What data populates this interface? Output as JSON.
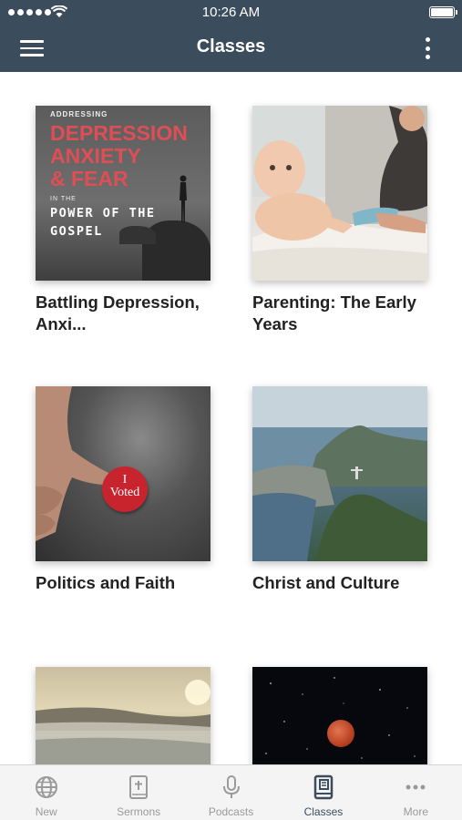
{
  "status_bar": {
    "time": "10:26 AM"
  },
  "header": {
    "title": "Classes"
  },
  "classes": [
    {
      "title": "Battling Depression, Anxi...",
      "artwork": {
        "top_text": "ADDRESSING",
        "headline": [
          "DEPRESSION",
          "ANXIETY",
          "& FEAR"
        ],
        "in_the": "IN THE",
        "subline": [
          "POWER OF THE",
          "GOSPEL"
        ]
      }
    },
    {
      "title": "Parenting: The Early Years"
    },
    {
      "title": "Politics and Faith",
      "artwork": {
        "sticker": [
          "I",
          "Voted"
        ]
      }
    },
    {
      "title": "Christ and Culture"
    },
    {
      "title": ""
    },
    {
      "title": ""
    }
  ],
  "tabs": [
    {
      "label": "New",
      "icon": "globe-icon"
    },
    {
      "label": "Sermons",
      "icon": "bible-icon"
    },
    {
      "label": "Podcasts",
      "icon": "microphone-icon"
    },
    {
      "label": "Classes",
      "icon": "book-icon",
      "active": true
    },
    {
      "label": "More",
      "icon": "ellipsis-icon"
    }
  ],
  "colors": {
    "header_bg": "#3b4d5c",
    "accent_red": "#e04e55",
    "tab_inactive": "#9a9a9a",
    "tab_active": "#3b4d5c"
  }
}
